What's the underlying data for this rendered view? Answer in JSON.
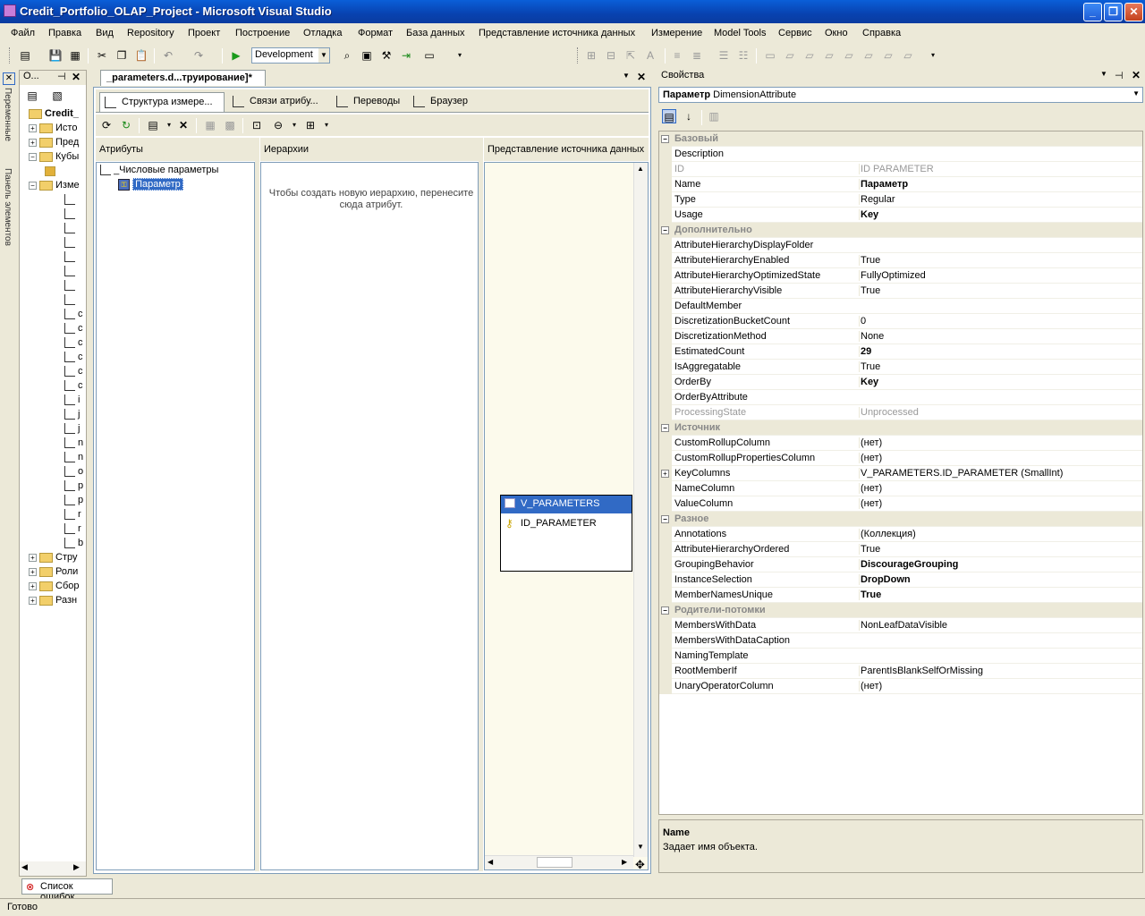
{
  "window": {
    "title": "Credit_Portfolio_OLAP_Project - Microsoft Visual Studio",
    "min_label": "_",
    "max_label": "❐",
    "close_label": "✕"
  },
  "menu": [
    "Файл",
    "Правка",
    "Вид",
    "Repository",
    "Проект",
    "Построение",
    "Отладка",
    "Формат",
    "База данных",
    "Представление источника данных",
    "Измерение",
    "Model Tools",
    "Сервис",
    "Окно",
    "Справка"
  ],
  "toolbar": {
    "configuration": "Development"
  },
  "side_strip": {
    "variables": "Переменные",
    "toolbox": "Панель элементов"
  },
  "solution_explorer": {
    "title": "О...",
    "items": [
      {
        "label": "Credit_",
        "bold": true
      },
      {
        "label": "Исто"
      },
      {
        "label": "Пред"
      },
      {
        "label": "Кубы"
      },
      {
        "label": ""
      },
      {
        "label": "Изме"
      },
      {
        "label": "Стру"
      },
      {
        "label": "Роли"
      },
      {
        "label": "Сбор"
      },
      {
        "label": "Разн"
      }
    ],
    "attr_letters": [
      "",
      "",
      "",
      "",
      "",
      "",
      "",
      "",
      "c",
      "c",
      "c",
      "c",
      "c",
      "c",
      "i",
      "j",
      "j",
      "n",
      "n",
      "o",
      "p",
      "p",
      "r",
      "r",
      "b"
    ]
  },
  "document": {
    "tab_title": "_parameters.d...труирование]*",
    "design_tabs": [
      "Структура измере...",
      "Связи атрибу...",
      "Переводы",
      "Браузер"
    ],
    "panes": {
      "attributes": "Атрибуты",
      "hierarchies": "Иерархии",
      "dsv": "Представление источника данных"
    },
    "dimension_name": "_Числовые параметры",
    "selected_attribute": "Параметр",
    "hierarchy_hint": "Чтобы создать новую иерархию, перенесите сюда атрибут.",
    "dsv_table": {
      "name": "V_PARAMETERS",
      "column": "ID_PARAMETER"
    }
  },
  "properties": {
    "title": "Свойства",
    "object_name": "Параметр",
    "object_type": "DimensionAttribute",
    "rows": [
      {
        "cat": "Базовый"
      },
      {
        "name": "Description",
        "value": ""
      },
      {
        "name": "ID",
        "value": "ID PARAMETER",
        "gray": true
      },
      {
        "name": "Name",
        "value": "Параметр",
        "bold": true
      },
      {
        "name": "Type",
        "value": "Regular"
      },
      {
        "name": "Usage",
        "value": "Key",
        "bold": true
      },
      {
        "cat": "Дополнительно"
      },
      {
        "name": "AttributeHierarchyDisplayFolder",
        "value": ""
      },
      {
        "name": "AttributeHierarchyEnabled",
        "value": "True"
      },
      {
        "name": "AttributeHierarchyOptimizedState",
        "value": "FullyOptimized"
      },
      {
        "name": "AttributeHierarchyVisible",
        "value": "True"
      },
      {
        "name": "DefaultMember",
        "value": ""
      },
      {
        "name": "DiscretizationBucketCount",
        "value": "0"
      },
      {
        "name": "DiscretizationMethod",
        "value": "None"
      },
      {
        "name": "EstimatedCount",
        "value": "29",
        "bold": true
      },
      {
        "name": "IsAggregatable",
        "value": "True"
      },
      {
        "name": "OrderBy",
        "value": "Key",
        "bold": true
      },
      {
        "name": "OrderByAttribute",
        "value": ""
      },
      {
        "name": "ProcessingState",
        "value": "Unprocessed",
        "gray": true
      },
      {
        "cat": "Источник"
      },
      {
        "name": "CustomRollupColumn",
        "value": "(нет)"
      },
      {
        "name": "CustomRollupPropertiesColumn",
        "value": "(нет)"
      },
      {
        "name": "KeyColumns",
        "value": "V_PARAMETERS.ID_PARAMETER (SmallInt)",
        "expand": true
      },
      {
        "name": "NameColumn",
        "value": "(нет)"
      },
      {
        "name": "ValueColumn",
        "value": "(нет)"
      },
      {
        "cat": "Разное"
      },
      {
        "name": "Annotations",
        "value": "(Коллекция)"
      },
      {
        "name": "AttributeHierarchyOrdered",
        "value": "True"
      },
      {
        "name": "GroupingBehavior",
        "value": "DiscourageGrouping",
        "bold": true
      },
      {
        "name": "InstanceSelection",
        "value": "DropDown",
        "bold": true
      },
      {
        "name": "MemberNamesUnique",
        "value": "True",
        "bold": true
      },
      {
        "cat": "Родители-потомки"
      },
      {
        "name": "MembersWithData",
        "value": "NonLeafDataVisible"
      },
      {
        "name": "MembersWithDataCaption",
        "value": ""
      },
      {
        "name": "NamingTemplate",
        "value": ""
      },
      {
        "name": "RootMemberIf",
        "value": "ParentIsBlankSelfOrMissing"
      },
      {
        "name": "UnaryOperatorColumn",
        "value": "(нет)"
      }
    ],
    "description_title": "Name",
    "description_text": "Задает имя объекта."
  },
  "bottom": {
    "error_list": "Список ошибок",
    "status": "Готово"
  },
  "colors": {
    "titlebar": "#0a5fd8",
    "selection": "#316ac5",
    "panel": "#ece9d8",
    "dsv_background": "#fcfaec"
  }
}
